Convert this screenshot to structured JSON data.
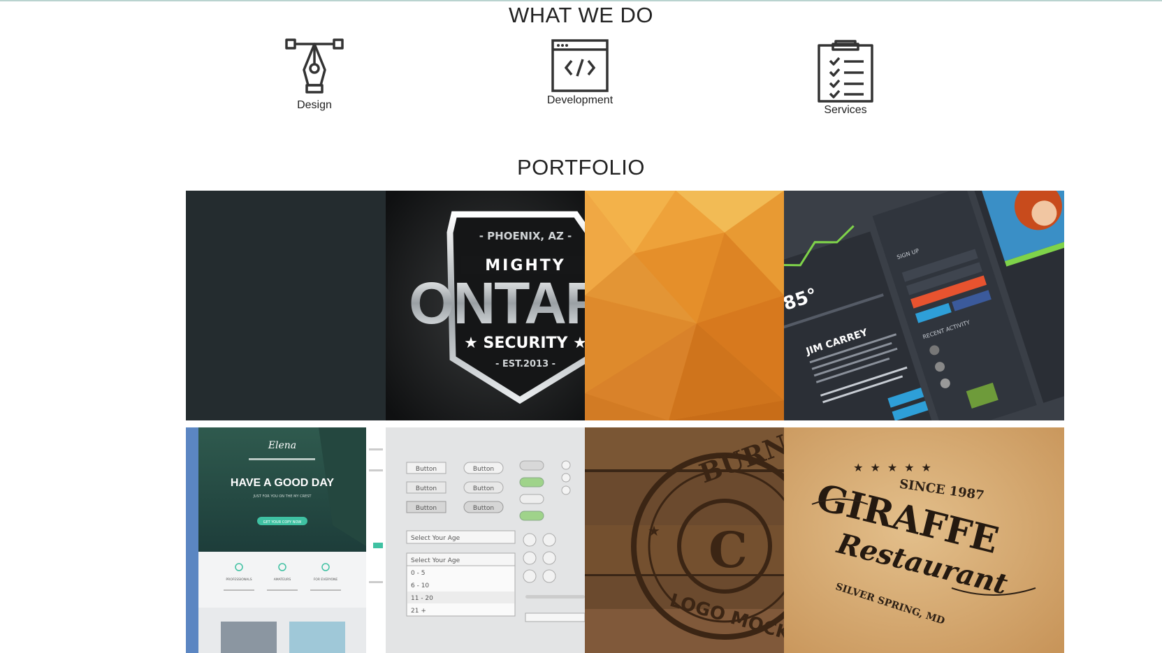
{
  "what_we_do": {
    "title": "WHAT WE DO",
    "services": [
      {
        "label": "Design",
        "icon": "pen-tool-icon"
      },
      {
        "label": "Development",
        "icon": "code-window-icon"
      },
      {
        "label": "Services",
        "icon": "clipboard-checklist-icon"
      }
    ]
  },
  "portfolio": {
    "title": "PORTFOLIO",
    "items": [
      {
        "name": "portfolio-item-dark-blank",
        "caption": ""
      },
      {
        "name": "portfolio-item-mighty-ontario",
        "text": {
          "top": "- PHOENIX, AZ -",
          "mighty": "MIGHTY",
          "main": "ONTARI",
          "security": "★ SECURITY ★",
          "est": "- EST.2013 -"
        }
      },
      {
        "name": "portfolio-item-orange-polygon"
      },
      {
        "name": "portfolio-item-dashboard-ui",
        "text": {
          "temp": "85°",
          "name": "JIM CARREY",
          "login": "SIGN UP",
          "activity": "RECENT ACTIVITY"
        }
      },
      {
        "name": "portfolio-item-elena-theme",
        "text": {
          "brand": "Elena",
          "headline": "HAVE A GOOD DAY",
          "sub": "JUST FOR YOU ON THE MY CREST",
          "cta": "GET YOUR COPY NOW",
          "f1": "PROFESSIONALS",
          "f2": "AMATEURS",
          "f3": "FOR EVERYONE"
        }
      },
      {
        "name": "portfolio-item-ui-kit",
        "text": {
          "button": "Button",
          "select": "Select Your Age",
          "opt1": "0 - 5",
          "opt2": "6 - 10",
          "opt3": "11 - 20",
          "opt4": "21 +"
        }
      },
      {
        "name": "portfolio-item-wood-stamp",
        "text": {
          "top": "BURNE",
          "bottom": "LOGO MOCK-U",
          "center": "C"
        }
      },
      {
        "name": "portfolio-item-giraffe-restaurant",
        "text": {
          "since": "SINCE 1987",
          "main": "GIRAFFE",
          "script": "Restaurant",
          "place": "SILVER SPRING, MD"
        }
      }
    ]
  },
  "colors": {
    "dark_tile": "#242c2f",
    "orange": "#e8942e",
    "dashboard_bg": "#2c3038",
    "kraft": "#d5aa72",
    "wood": "#6b4a2e"
  }
}
